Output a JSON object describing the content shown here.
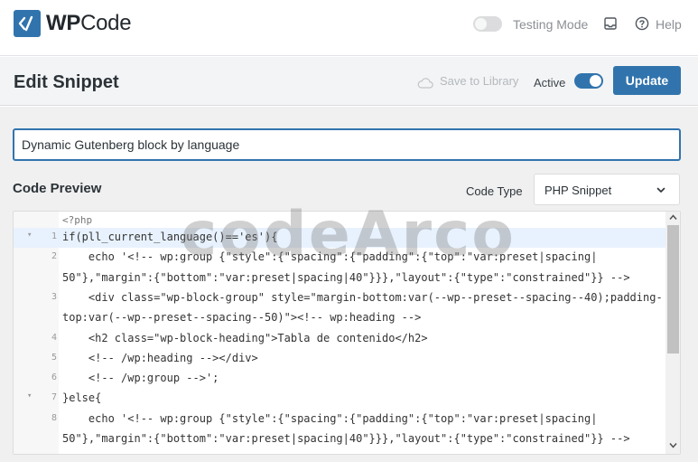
{
  "app": {
    "brand_part1": "WP",
    "brand_part2": "Code",
    "testing_mode_label": "Testing Mode",
    "help_label": "Help"
  },
  "header": {
    "title": "Edit Snippet",
    "save_to_library": "Save to Library",
    "active_label": "Active",
    "active": true,
    "update_label": "Update"
  },
  "snippet": {
    "title_value": "Dynamic Gutenberg block by language"
  },
  "preview": {
    "label": "Code Preview",
    "code_type_label": "Code Type",
    "code_type_value": "PHP Snippet"
  },
  "editor": {
    "lines": [
      {
        "num": "",
        "fold": "",
        "code": "<?php"
      },
      {
        "num": "1",
        "fold": "▾",
        "code": "if(pll_current_language()=='es'){"
      },
      {
        "num": "2",
        "fold": "",
        "code": "    echo '<!-- wp:group {\"style\":{\"spacing\":{\"padding\":{\"top\":\"var:preset|spacing|"
      },
      {
        "num": "",
        "fold": "",
        "code": "50\"},\"margin\":{\"bottom\":\"var:preset|spacing|40\"}}},\"layout\":{\"type\":\"constrained\"}} -->"
      },
      {
        "num": "3",
        "fold": "",
        "code": "    <div class=\"wp-block-group\" style=\"margin-bottom:var(--wp--preset--spacing--40);padding-"
      },
      {
        "num": "",
        "fold": "",
        "code": "top:var(--wp--preset--spacing--50)\"><!-- wp:heading -->"
      },
      {
        "num": "4",
        "fold": "",
        "code": "    <h2 class=\"wp-block-heading\">Tabla de contenido</h2>"
      },
      {
        "num": "5",
        "fold": "",
        "code": "    <!-- /wp:heading --></div>"
      },
      {
        "num": "6",
        "fold": "",
        "code": "    <!-- /wp:group -->';"
      },
      {
        "num": "7",
        "fold": "▾",
        "code": "}else{"
      },
      {
        "num": "8",
        "fold": "",
        "code": "    echo '<!-- wp:group {\"style\":{\"spacing\":{\"padding\":{\"top\":\"var:preset|spacing|"
      },
      {
        "num": "",
        "fold": "",
        "code": "50\"},\"margin\":{\"bottom\":\"var:preset|spacing|40\"}}},\"layout\":{\"type\":\"constrained\"}} -->"
      }
    ]
  },
  "watermark": "codeArco",
  "colors": {
    "accent": "#3174ad",
    "header_bg": "#f3f4f5",
    "content_bg": "#f0f0f1"
  }
}
